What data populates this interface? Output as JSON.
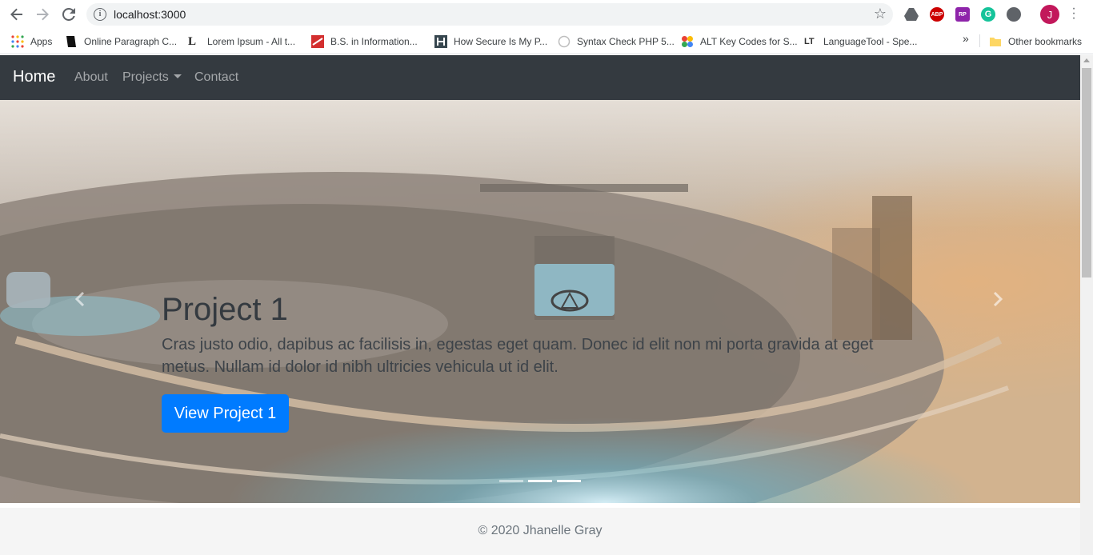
{
  "browser": {
    "url": "localhost:3000",
    "avatar_initial": "J",
    "bookmarks": [
      {
        "label": "Apps",
        "icon": "apps-grid-icon"
      },
      {
        "label": "Online Paragraph C...",
        "icon": "paragraph-icon"
      },
      {
        "label": "Lorem Ipsum - All t...",
        "icon": "lorem-icon"
      },
      {
        "label": "B.S. in Information...",
        "icon": "bs-icon"
      },
      {
        "label": "How Secure Is My P...",
        "icon": "secure-icon"
      },
      {
        "label": "Syntax Check PHP 5...",
        "icon": "syntax-icon"
      },
      {
        "label": "ALT Key Codes for S...",
        "icon": "altkey-icon"
      },
      {
        "label": "LanguageTool - Spe...",
        "icon": "languagetool-icon"
      }
    ],
    "other_bookmarks": "Other bookmarks",
    "more_chevron": "»",
    "extensions": {
      "abp": "ABP",
      "rp": "RP"
    }
  },
  "site": {
    "brand": "Home",
    "nav": {
      "about": "About",
      "projects": "Projects",
      "contact": "Contact"
    }
  },
  "carousel": {
    "title": "Project 1",
    "text": "Cras justo odio, dapibus ac facilisis in, egestas eget quam. Donec id elit non mi porta gravida at eget metus. Nullam id dolor id nibh ultricies vehicula ut id elit.",
    "button": "View Project 1",
    "slide_count": 3,
    "active_slide": 1
  },
  "footer": {
    "copyright": "© 2020 Jhanelle Gray"
  },
  "colors": {
    "navbar": "#343a40",
    "primary_button": "#007bff",
    "footer_bg": "#f5f5f5"
  }
}
